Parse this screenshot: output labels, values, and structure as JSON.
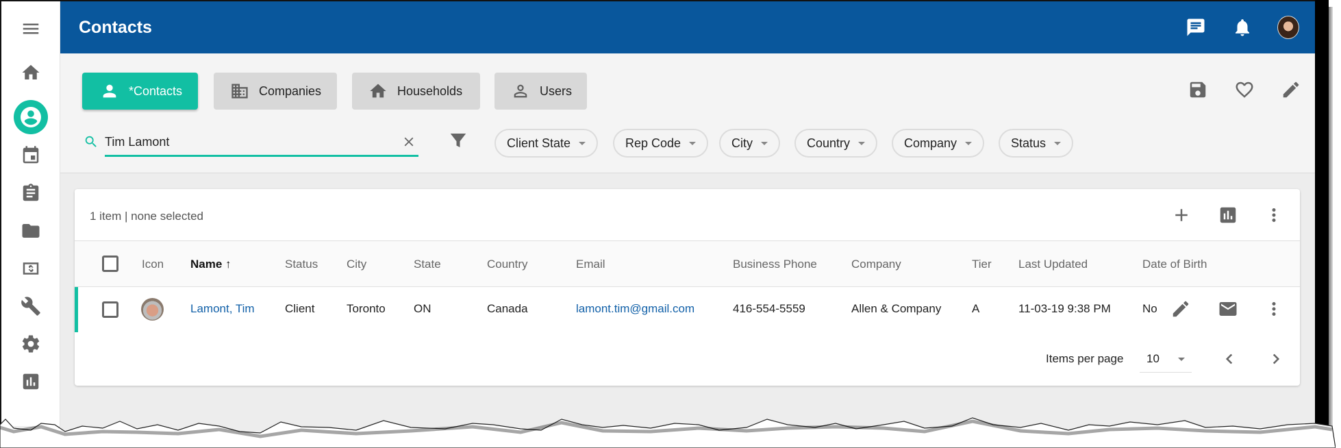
{
  "app": {
    "title": "Contacts",
    "brand_color": "#09579c",
    "accent_color": "#12bfa3"
  },
  "sidebar": {
    "items": [
      {
        "name": "menu",
        "icon": "menu-icon"
      },
      {
        "name": "home",
        "icon": "home-icon"
      },
      {
        "name": "contacts",
        "icon": "account-circle-icon",
        "active": true
      },
      {
        "name": "calendar",
        "icon": "calendar-icon"
      },
      {
        "name": "tasks",
        "icon": "clipboard-icon"
      },
      {
        "name": "documents",
        "icon": "folder-icon"
      },
      {
        "name": "billing",
        "icon": "dollar-icon"
      },
      {
        "name": "tools",
        "icon": "wrench-icon"
      },
      {
        "name": "settings",
        "icon": "gear-icon"
      },
      {
        "name": "reports",
        "icon": "bar-chart-icon"
      }
    ]
  },
  "header": {
    "icons": [
      "chat-icon",
      "bell-icon",
      "user-avatar"
    ]
  },
  "tabs": [
    {
      "label": "*Contacts",
      "icon": "person-icon",
      "active": true
    },
    {
      "label": "Companies",
      "icon": "building-icon",
      "active": false
    },
    {
      "label": "Households",
      "icon": "house-icon",
      "active": false
    },
    {
      "label": "Users",
      "icon": "person-outline-icon",
      "active": false
    }
  ],
  "toolbar_icons": [
    "save-icon",
    "heart-icon",
    "pencil-icon"
  ],
  "search": {
    "value": "Tim Lamont",
    "placeholder": "Search"
  },
  "filters": [
    {
      "label": "Client State"
    },
    {
      "label": "Rep Code"
    },
    {
      "label": "City"
    },
    {
      "label": "Country"
    },
    {
      "label": "Company"
    },
    {
      "label": "Status"
    }
  ],
  "table": {
    "summary": "1 item | none selected",
    "toolbar_icons": [
      "add-icon",
      "bar-chart-icon",
      "more-vert-icon"
    ],
    "columns": [
      "Icon",
      "Name",
      "Status",
      "City",
      "State",
      "Country",
      "Email",
      "Business Phone",
      "Company",
      "Tier",
      "Last Updated",
      "Date of Birth"
    ],
    "sorted_column": "Name",
    "sort_direction": "ascending",
    "rows": [
      {
        "name": "Lamont, Tim",
        "status": "Client",
        "city": "Toronto",
        "state": "ON",
        "country": "Canada",
        "email": "lamont.tim@gmail.com",
        "business_phone": "416-554-5559",
        "company": "Allen & Company",
        "tier": "A",
        "last_updated": "11-03-19 9:38 PM",
        "date_of_birth": "No"
      }
    ],
    "row_actions": [
      "pencil-icon",
      "email-icon",
      "more-vert-icon"
    ]
  },
  "paginator": {
    "items_per_page_label": "Items per page",
    "items_per_page": "10"
  }
}
